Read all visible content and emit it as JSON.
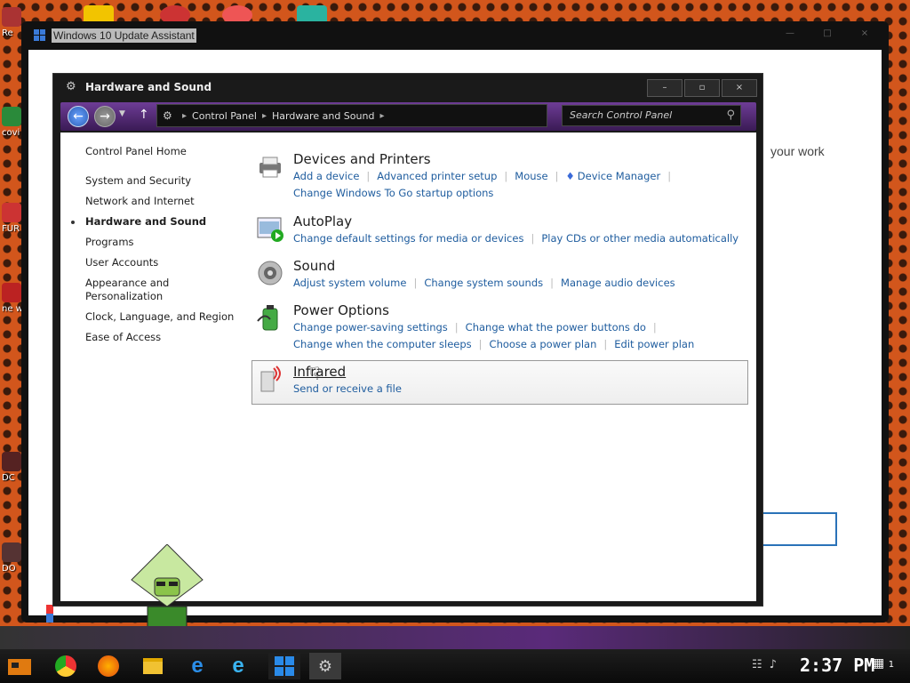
{
  "desktop": {
    "icons": [
      {
        "label": "Re",
        "top": 0
      },
      {
        "label": "covi boos",
        "top": 0
      },
      {
        "label": "FUR",
        "top": 0
      },
      {
        "label": "ne wh",
        "top": 0
      },
      {
        "label": "DC",
        "top": 0
      },
      {
        "label": "DO",
        "top": 0
      }
    ]
  },
  "update_assistant": {
    "title": "Windows 10 Update Assistant",
    "bg_text": "your work",
    "controls": {
      "minimize": "—",
      "maximize": "□",
      "close": "×"
    }
  },
  "control_panel": {
    "title": "Hardware and Sound",
    "controls": {
      "minimize": "–",
      "maximize": "▫",
      "close": "×"
    },
    "breadcrumb": [
      "Control Panel",
      "Hardware and Sound"
    ],
    "search_placeholder": "Search Control Panel",
    "left_nav": {
      "home": "Control Panel Home",
      "items": [
        "System and Security",
        "Network and Internet",
        "Hardware and Sound",
        "Programs",
        "User Accounts",
        "Appearance and Personalization",
        "Clock, Language, and Region",
        "Ease of Access"
      ],
      "current": "Hardware and Sound"
    },
    "categories": [
      {
        "title": "Devices and Printers",
        "icon": "printer-icon",
        "links": [
          "Add a device",
          "Advanced printer setup",
          "Mouse",
          "Device Manager",
          "Change Windows To Go startup options"
        ]
      },
      {
        "title": "AutoPlay",
        "icon": "autoplay-icon",
        "links": [
          "Change default settings for media or devices",
          "Play CDs or other media automatically"
        ]
      },
      {
        "title": "Sound",
        "icon": "speaker-icon",
        "links": [
          "Adjust system volume",
          "Change system sounds",
          "Manage audio devices"
        ]
      },
      {
        "title": "Power Options",
        "icon": "battery-icon",
        "links": [
          "Change power-saving settings",
          "Change what the power buttons do",
          "Change when the computer sleeps",
          "Choose a power plan",
          "Edit power plan"
        ]
      },
      {
        "title": "Infrared",
        "icon": "infrared-icon",
        "links": [
          "Send or receive a file"
        ]
      }
    ]
  },
  "taskbar": {
    "clock": "2:37 PM",
    "notification_count": "1",
    "apps": [
      "chrome",
      "firefox",
      "file-explorer",
      "edge",
      "internet-explorer",
      "windows-logo",
      "game-app"
    ]
  },
  "colors": {
    "link": "#1e5c9e",
    "nav_bar": "#6e3d96",
    "desktop_bg": "#d2561c"
  }
}
